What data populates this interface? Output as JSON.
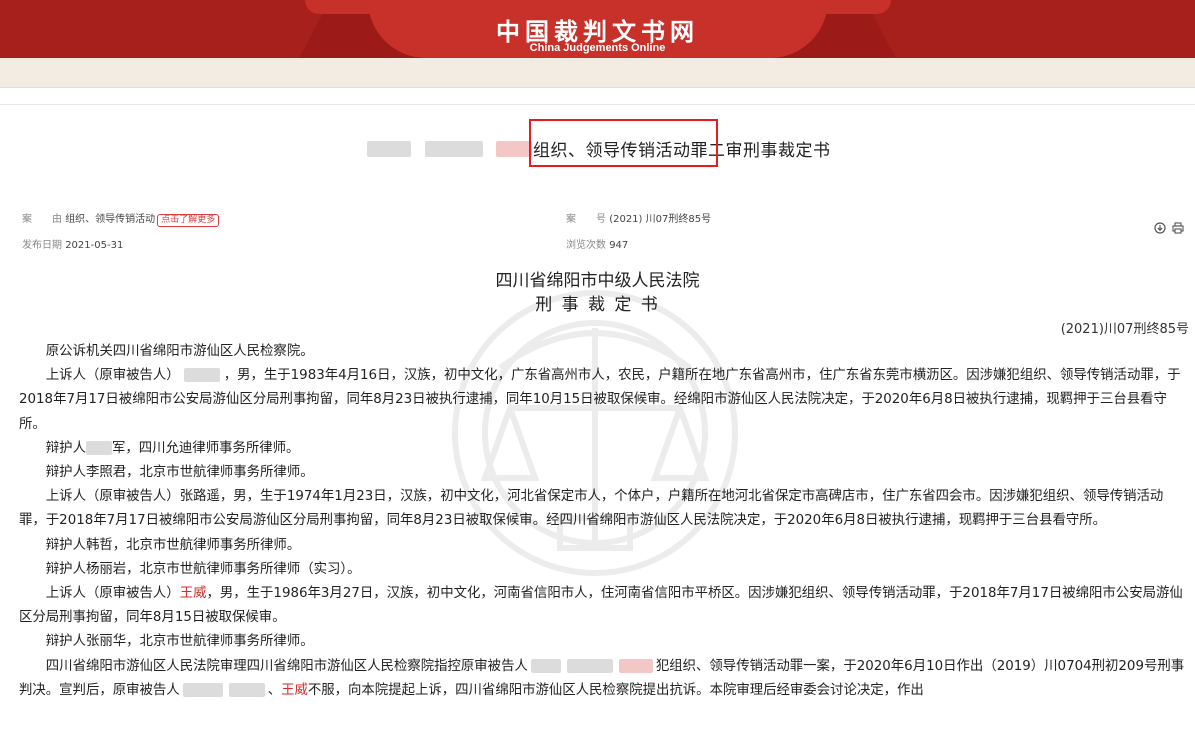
{
  "site": {
    "title": "中国裁判文书网",
    "subtitle": "China Judgements Online"
  },
  "doc": {
    "title": "组织、领导传销活动罪二审刑事裁定书"
  },
  "meta": {
    "cause_key": "案　　由",
    "cause_val": "组织、领导传销活动",
    "tag": "点击了解更多",
    "caseno_key": "案　　号",
    "caseno_val": "(2021) 川07刑终85号",
    "date_key": "发布日期",
    "date_val": "2021-05-31",
    "views_key": "浏览次数",
    "views_val": "947"
  },
  "tools": {
    "download_icon": "download-icon",
    "print_icon": "print-icon"
  },
  "court": {
    "name": "四川省绵阳市中级人民法院",
    "doctype": "刑 事 裁 定 书",
    "caseno": "(2021)川07刑终85号"
  },
  "body": {
    "p1": "原公诉机关四川省绵阳市游仙区人民检察院。",
    "p2a": "上诉人（原审被告人）",
    "p2b": "，男，生于1983年4月16日，汉族，初中文化，广东省高州市人，农民，户籍所在地广东省高州市，住广东省东莞市横沥区。因涉嫌犯组织、领导传销活动罪，于2018年7月17日被绵阳市公安局游仙区分局刑事拘留，同年8月23日被执行逮捕，同年10月15日被取保候审。经绵阳市游仙区人民法院决定，于2020年6月8日被执行逮捕，现羁押于三台县看守所。",
    "p3a": "辩护人",
    "p3b": "军，四川允迪律师事务所律师。",
    "p4": "辩护人李照君，北京市世航律师事务所律师。",
    "p5": "上诉人（原审被告人）张路遥，男，生于1974年1月23日，汉族，初中文化，河北省保定市人，个体户，户籍所在地河北省保定市高碑店市，住广东省四会市。因涉嫌犯组织、领导传销活动罪，于2018年7月17日被绵阳市公安局游仙区分局刑事拘留，同年8月23日被取保候审。经四川省绵阳市游仙区人民法院决定，于2020年6月8日被执行逮捕，现羁押于三台县看守所。",
    "p6": "辩护人韩哲，北京市世航律师事务所律师。",
    "p7": "辩护人杨丽岩，北京市世航律师事务所律师（实习）。",
    "p8a": "上诉人（原审被告人）",
    "p8name": "王威",
    "p8b": "，男，生于1986年3月27日，汉族，初中文化，河南省信阳市人，住河南省信阳市平桥区。因涉嫌犯组织、领导传销活动罪，于2018年7月17日被绵阳市公安局游仙区分局刑事拘留，同年8月15日被取保候审。",
    "p9": "辩护人张丽华，北京市世航律师事务所律师。",
    "p10a": "四川省绵阳市游仙区人民法院审理四川省绵阳市游仙区人民检察院指控原审被告人",
    "p10b": "犯组织、领导传销活动罪一案，于2020年6月10日作出（2019）川0704刑初209号刑事判决。宣判后，原审被告人",
    "p10c": "、",
    "p10name": "王威",
    "p10d": "不服，向本院提起上诉，四川省绵阳市游仙区人民检察院提出抗诉。本院审理后经审委会讨论决定，作出"
  }
}
